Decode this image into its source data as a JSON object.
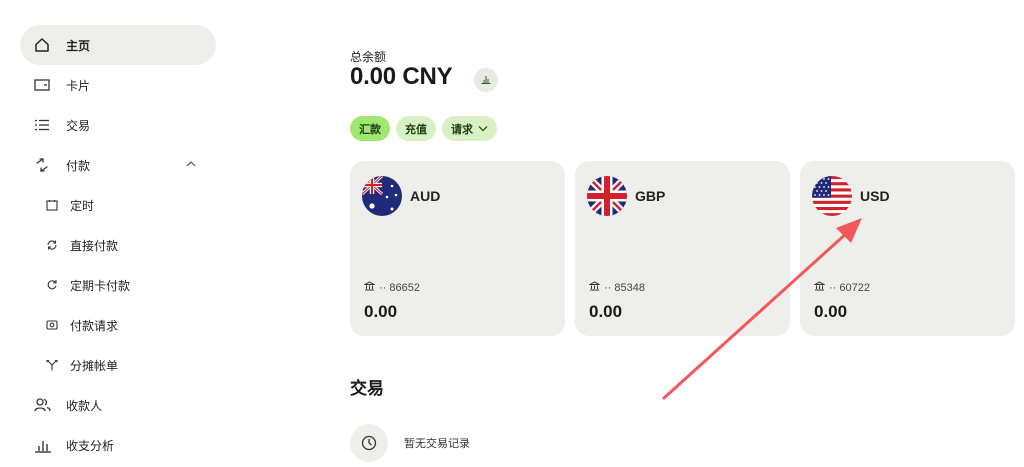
{
  "sidebar": {
    "items": [
      {
        "label": "主页",
        "icon": "home-icon"
      },
      {
        "label": "卡片",
        "icon": "card-icon"
      },
      {
        "label": "交易",
        "icon": "list-icon"
      },
      {
        "label": "付款",
        "icon": "transfer-icon"
      },
      {
        "label": "定时",
        "icon": "calendar-icon"
      },
      {
        "label": "直接付款",
        "icon": "refresh-icon"
      },
      {
        "label": "定期卡付款",
        "icon": "recurring-icon"
      },
      {
        "label": "付款请求",
        "icon": "request-icon"
      },
      {
        "label": "分摊帐单",
        "icon": "split-icon"
      },
      {
        "label": "收款人",
        "icon": "recipients-icon"
      },
      {
        "label": "收支分析",
        "icon": "insights-icon"
      }
    ]
  },
  "balance": {
    "label": "总余额",
    "amount": "0.00 CNY"
  },
  "actions": {
    "send": "汇款",
    "topup": "充值",
    "request": "请求"
  },
  "accounts": [
    {
      "currency": "AUD",
      "account": "·· 86652",
      "amount": "0.00",
      "flag": "au-flag-icon"
    },
    {
      "currency": "GBP",
      "account": "·· 85348",
      "amount": "0.00",
      "flag": "gb-flag-icon"
    },
    {
      "currency": "USD",
      "account": "·· 60722",
      "amount": "0.00",
      "flag": "us-flag-icon"
    }
  ],
  "transactions": {
    "title": "交易",
    "empty_message": "暂无交易记录"
  },
  "colors": {
    "accent": "#9fe870",
    "accent_light": "#d9f0c4",
    "card_bg": "#eeeeea",
    "annotation_arrow": "#f0585a"
  }
}
